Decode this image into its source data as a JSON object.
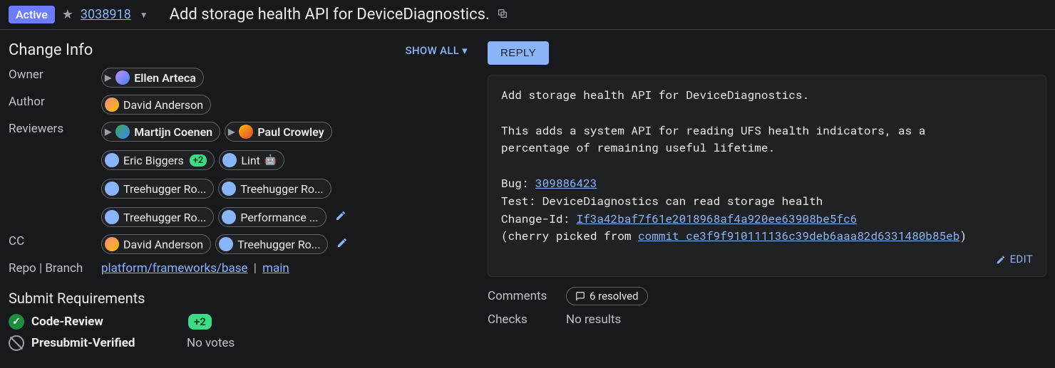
{
  "header": {
    "status_badge": "Active",
    "change_number": "3038918",
    "title": "Add storage health API for DeviceDiagnostics."
  },
  "change_info": {
    "heading": "Change Info",
    "show_all": "SHOW ALL",
    "labels": {
      "owner": "Owner",
      "author": "Author",
      "reviewers": "Reviewers",
      "cc": "CC",
      "repo_branch": "Repo | Branch"
    },
    "owner": {
      "name": "Ellen Arteca",
      "attention": true
    },
    "author": {
      "name": "David Anderson"
    },
    "reviewers": [
      {
        "name": "Martijn Coenen",
        "attention": true,
        "bold": true
      },
      {
        "name": "Paul Crowley",
        "attention": true,
        "bold": true
      },
      {
        "name": "Eric Biggers",
        "badge": "+2"
      },
      {
        "name": "Lint",
        "robot": true
      },
      {
        "name": "Treehugger Ro..."
      },
      {
        "name": "Treehugger Ro..."
      },
      {
        "name": "Treehugger Ro..."
      },
      {
        "name": "Performance ..."
      }
    ],
    "cc": [
      {
        "name": "David Anderson"
      },
      {
        "name": "Treehugger Ro..."
      }
    ],
    "repo": "platform/frameworks/base",
    "branch": "main"
  },
  "submit_requirements": {
    "heading": "Submit Requirements",
    "items": [
      {
        "name": "Code-Review",
        "status": "ok",
        "vote": "+2"
      },
      {
        "name": "Presubmit-Verified",
        "status": "none",
        "vote_text": "No votes"
      }
    ]
  },
  "right": {
    "reply": "REPLY",
    "commit_message": {
      "subject": "Add storage health API for DeviceDiagnostics.",
      "body": "This adds a system API for reading UFS health indicators, as a\npercentage of remaining useful lifetime.",
      "bug_label": "Bug: ",
      "bug": "309886423",
      "test": "Test: DeviceDiagnostics can read storage health",
      "changeid_label": "Change-Id: ",
      "changeid": "If3a42baf7f61e2018968af4a920ee63908be5fc6",
      "cherry_prefix": "(cherry picked from ",
      "cherry_link": "commit ce3f9f910111136c39deb6aaa82d6331480b85eb",
      "cherry_suffix": ")"
    },
    "edit": "EDIT",
    "comments_label": "Comments",
    "comments_resolved": "6 resolved",
    "checks_label": "Checks",
    "checks_value": "No results"
  }
}
